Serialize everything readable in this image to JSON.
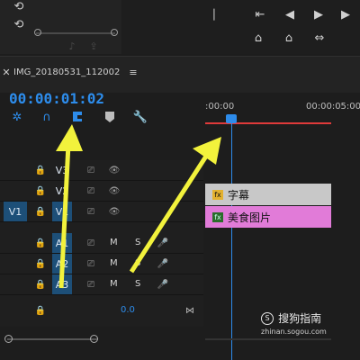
{
  "sequence": {
    "tab_title": "IMG_20180531_112002",
    "menu_icon": "hamburger-icon",
    "timecode": "00:00:01:02",
    "ruler": {
      "start": ":00:00",
      "end": "00:00:05:00"
    },
    "zoom_value": "0.0"
  },
  "tracks": {
    "source_patch": "V1",
    "video": [
      {
        "label": "V3",
        "targeted": false
      },
      {
        "label": "V2",
        "targeted": false
      },
      {
        "label": "V1",
        "targeted": true
      }
    ],
    "audio": [
      {
        "label": "A1",
        "targeted": true,
        "mute": "M",
        "solo": "S"
      },
      {
        "label": "A2",
        "targeted": true,
        "mute": "M",
        "solo": "S"
      },
      {
        "label": "A3",
        "targeted": true,
        "mute": "M",
        "solo": "S"
      }
    ]
  },
  "clips": [
    {
      "fx_badge": "fx",
      "name": "字幕",
      "color": "#c8c8c8"
    },
    {
      "fx_badge": "fx",
      "name": "美食图片",
      "color": "#e17bd8"
    }
  ],
  "watermark": {
    "brand": "搜狗指南",
    "url": "zhinan.sogou.com"
  },
  "colors": {
    "accent": "#2d8ceb",
    "playhead": "#2d8ceb",
    "ruler_line": "#e03a3a",
    "arrow": "#f2f23c"
  }
}
